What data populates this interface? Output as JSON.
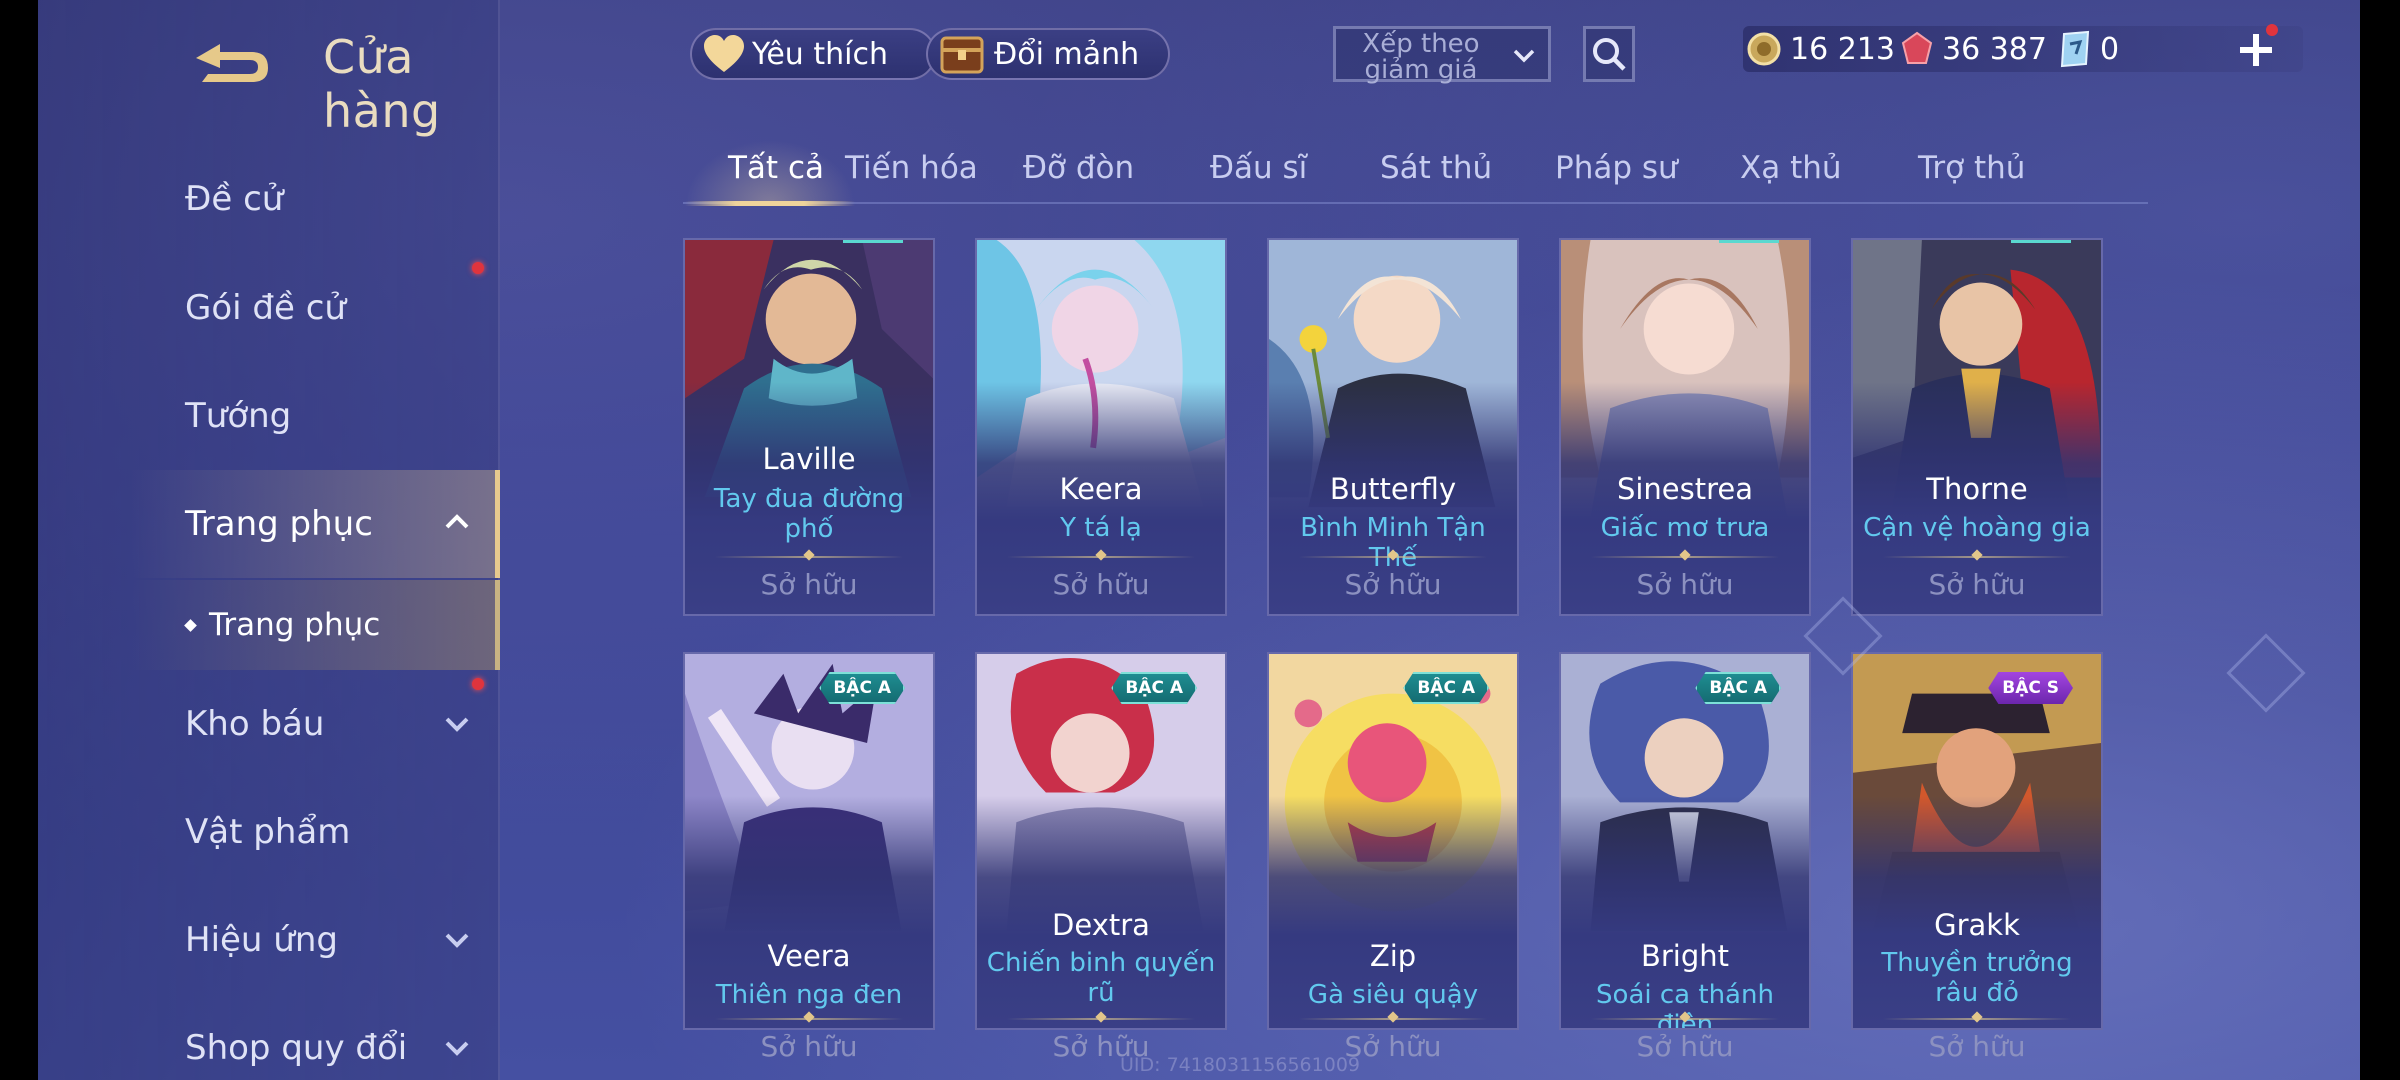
{
  "header": {
    "title": "Cửa hàng"
  },
  "sidebar": {
    "items": [
      {
        "label": "Đề cử"
      },
      {
        "label": "Gói đề cử"
      },
      {
        "label": "Tướng"
      },
      {
        "label": "Trang phục"
      },
      {
        "label": "Kho báu"
      },
      {
        "label": "Vật phẩm"
      },
      {
        "label": "Hiệu ứng"
      },
      {
        "label": "Shop quy đổi"
      }
    ],
    "sub_item": {
      "label": "Trang phục"
    }
  },
  "topbar": {
    "favorite_label": "Yêu thích",
    "exchange_label": "Đổi mảnh",
    "sort_label": "Xếp theo giảm giá",
    "currency_gold": "16 213",
    "currency_ruby": "36 387",
    "currency_voucher": "0"
  },
  "tabs": [
    {
      "label": "Tất cả"
    },
    {
      "label": "Tiến hóa"
    },
    {
      "label": "Đỡ đòn"
    },
    {
      "label": "Đấu sĩ"
    },
    {
      "label": "Sát thủ"
    },
    {
      "label": "Pháp sư"
    },
    {
      "label": "Xạ thủ"
    },
    {
      "label": "Trợ thủ"
    }
  ],
  "cards": [
    {
      "hero": "Laville",
      "skin": "Tay đua đường phố",
      "status": "Sở hữu"
    },
    {
      "hero": "Keera",
      "skin": "Y tá lạ",
      "status": "Sở hữu"
    },
    {
      "hero": "Butterfly",
      "skin": "Bình Minh Tận Thế",
      "status": "Sở hữu"
    },
    {
      "hero": "Sinestrea",
      "skin": "Giấc mơ trưa",
      "status": "Sở hữu"
    },
    {
      "hero": "Thorne",
      "skin": "Cận vệ hoàng gia",
      "status": "Sở hữu"
    },
    {
      "hero": "Veera",
      "skin": "Thiên nga đen",
      "status": "Sở hữu",
      "badge": "BẬC A"
    },
    {
      "hero": "Dextra",
      "skin": "Chiến binh quyến rũ",
      "status": "Sở hữu",
      "badge": "BẬC A"
    },
    {
      "hero": "Zip",
      "skin": "Gà siêu quậy",
      "status": "Sở hữu",
      "badge": "BẬC A"
    },
    {
      "hero": "Bright",
      "skin": "Soái ca thánh điện",
      "status": "Sở hữu",
      "badge": "BẬC A"
    },
    {
      "hero": "Grakk",
      "skin": "Thuyền trưởng râu đỏ",
      "status": "Sở hữu",
      "badge": "BẬC S"
    }
  ],
  "footer": {
    "uid": "UID: 7418031156561009"
  },
  "colors": {
    "accent_gold": "#efd49b",
    "skin_name": "#62c9ee",
    "badge_a": "#1f8f93",
    "badge_s": "#a345e0",
    "notify_red": "#e0343d"
  }
}
